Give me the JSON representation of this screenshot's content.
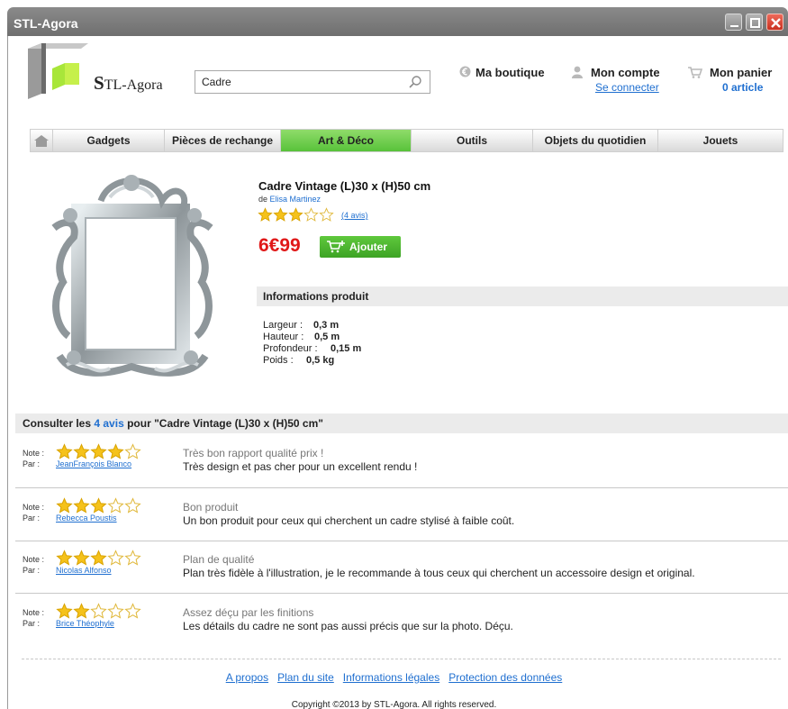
{
  "window": {
    "title": "STL-Agora"
  },
  "logo": {
    "first_letter": "S",
    "rest": "TL-Agora"
  },
  "search": {
    "value": "Cadre"
  },
  "header": {
    "shop_label": "Ma boutique",
    "account_label": "Mon compte",
    "account_link": "Se connecter",
    "cart_label": "Mon panier",
    "cart_count": "0 article"
  },
  "nav": {
    "items": [
      {
        "label": "Gadgets"
      },
      {
        "label": "Pièces de rechange"
      },
      {
        "label": "Art & Déco"
      },
      {
        "label": "Outils"
      },
      {
        "label": "Objets du quotidien"
      },
      {
        "label": "Jouets"
      }
    ],
    "active": "Art & Déco"
  },
  "product": {
    "title": "Cadre Vintage (L)30 x (H)50 cm",
    "author_prefix": "de",
    "author": "Elisa Martinez",
    "rating": 3,
    "rating_max": 5,
    "reviews_link": "(4 avis)",
    "price": "6€99",
    "add_button": "Ajouter",
    "info_title": "Informations produit",
    "specs": [
      {
        "label": "Largeur :",
        "value": "0,3 m"
      },
      {
        "label": "Hauteur :",
        "value": "0,5 m"
      },
      {
        "label": "Profondeur :",
        "value": "0,15 m"
      },
      {
        "label": "Poids :",
        "value": "0,5 kg"
      }
    ]
  },
  "reviews": {
    "header_prefix": "Consulter les",
    "header_count": "4 avis",
    "header_suffix": "pour \"Cadre Vintage (L)30 x (H)50 cm\"",
    "note_label": "Note :",
    "par_label": "Par :",
    "items": [
      {
        "rating": 4,
        "author": "JeanFrançois Blanco",
        "title": "Très bon rapport qualité prix !",
        "text": "Très design et pas cher pour un excellent rendu !"
      },
      {
        "rating": 3,
        "author": "Rebecca Poustis",
        "title": "Bon produit",
        "text": "Un bon produit pour ceux qui cherchent un cadre stylisé à faible coût."
      },
      {
        "rating": 3,
        "author": "Nicolas Alfonso",
        "title": "Plan de qualité",
        "text": "Plan très fidèle à l'illustration, je le recommande à tous ceux qui cherchent un accessoire design et original."
      },
      {
        "rating": 2,
        "author": "Brice Théophyle",
        "title": "Assez déçu par les finitions",
        "text": "Les détails du cadre ne sont pas aussi précis que sur la photo. Déçu."
      }
    ]
  },
  "footer": {
    "links": [
      "A propos",
      "Plan du site",
      "Informations légales",
      "Protection des données"
    ],
    "copyright": "Copyright ©2013 by STL-Agora. All rights reserved."
  },
  "colors": {
    "accent_green": "#58c23a",
    "price_red": "#e01818",
    "link_blue": "#1f6fd0",
    "star_gold": "#f5c21b"
  }
}
